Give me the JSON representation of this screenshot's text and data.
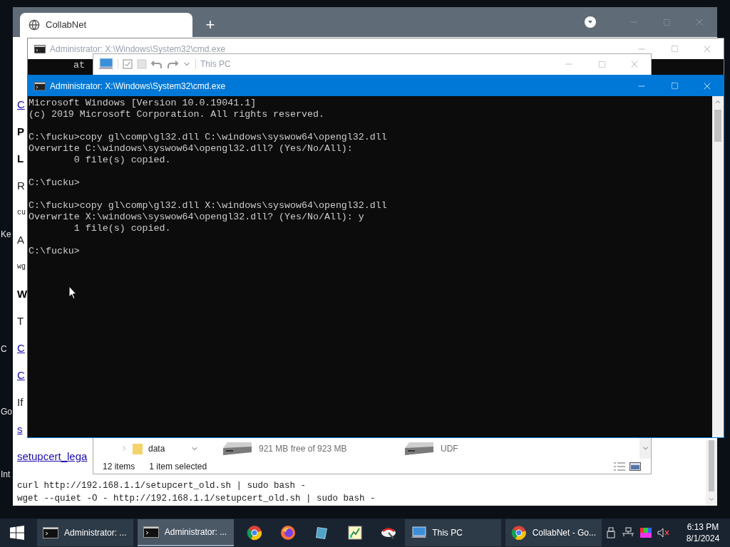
{
  "desktop": {
    "icon_labels": [
      "Ke",
      "C",
      "Go",
      "Int"
    ]
  },
  "browser": {
    "tabs": [
      {
        "label": "CollabNet",
        "selected": true
      }
    ],
    "new_tab": "+",
    "page": {
      "items": [
        {
          "kind": "link",
          "text": "C"
        },
        {
          "kind": "heading",
          "text": "P"
        },
        {
          "kind": "subheading",
          "text": "L"
        },
        {
          "kind": "para",
          "text": "R"
        },
        {
          "kind": "code",
          "text": "cu"
        },
        {
          "kind": "para",
          "text": "A"
        },
        {
          "kind": "code",
          "text": "wg"
        },
        {
          "kind": "heading",
          "text": "W"
        },
        {
          "kind": "para",
          "text": "T"
        },
        {
          "kind": "link",
          "text": "C"
        },
        {
          "kind": "link",
          "text": "C"
        },
        {
          "kind": "para",
          "text": "If"
        },
        {
          "kind": "link",
          "text": "s"
        },
        {
          "kind": "link",
          "text": "setupcert_lega"
        }
      ],
      "code": [
        "curl http://192.168.1.1/setupcert_old.sh | sudo bash -",
        "wget --quiet -O - http://192.168.1.1/setupcert_old.sh | sudo bash -"
      ]
    }
  },
  "background_console": {
    "title": "Administrator: X:\\Windows\\System32\\cmd.exe",
    "lines": [
      "at"
    ]
  },
  "explorer": {
    "title": "This PC",
    "nav_item": "data",
    "drives": [
      {
        "detail": "921 MB free of 923 MB"
      },
      {
        "detail": "UDF"
      }
    ],
    "item_count": "12 items",
    "selection": "1 item selected"
  },
  "console": {
    "title": "Administrator: X:\\Windows\\System32\\cmd.exe",
    "blocks": [
      [
        "Microsoft Windows [Version 10.0.19041.1]",
        "(c) 2019 Microsoft Corporation. All rights reserved."
      ],
      [
        "C:\\fucku>copy gl\\comp\\gl32.dll C:\\windows\\syswow64\\opengl32.dll",
        "Overwrite C:\\windows\\syswow64\\opengl32.dll? (Yes/No/All):",
        "        0 file(s) copied."
      ],
      [
        "C:\\fucku>"
      ],
      [
        "C:\\fucku>copy gl\\comp\\gl32.dll X:\\windows\\syswow64\\opengl32.dll",
        "Overwrite X:\\windows\\syswow64\\opengl32.dll? (Yes/No/All): y",
        "        1 file(s) copied."
      ],
      [
        "C:\\fucku>"
      ]
    ]
  },
  "taskbar": {
    "items": [
      {
        "kind": "console",
        "label": "Administrator: ...",
        "selected": false
      },
      {
        "kind": "console",
        "label": "Administrator: ...",
        "selected": true
      },
      {
        "kind": "chrome"
      },
      {
        "kind": "firefox"
      },
      {
        "kind": "notepad"
      },
      {
        "kind": "chart"
      },
      {
        "kind": "tool"
      },
      {
        "kind": "explorer",
        "label": "This PC",
        "selected": false
      },
      {
        "kind": "chrome",
        "label": "CollabNet - Go...",
        "selected": false
      }
    ],
    "clock": {
      "time": "6:13 PM",
      "date": "8/1/2024"
    }
  }
}
